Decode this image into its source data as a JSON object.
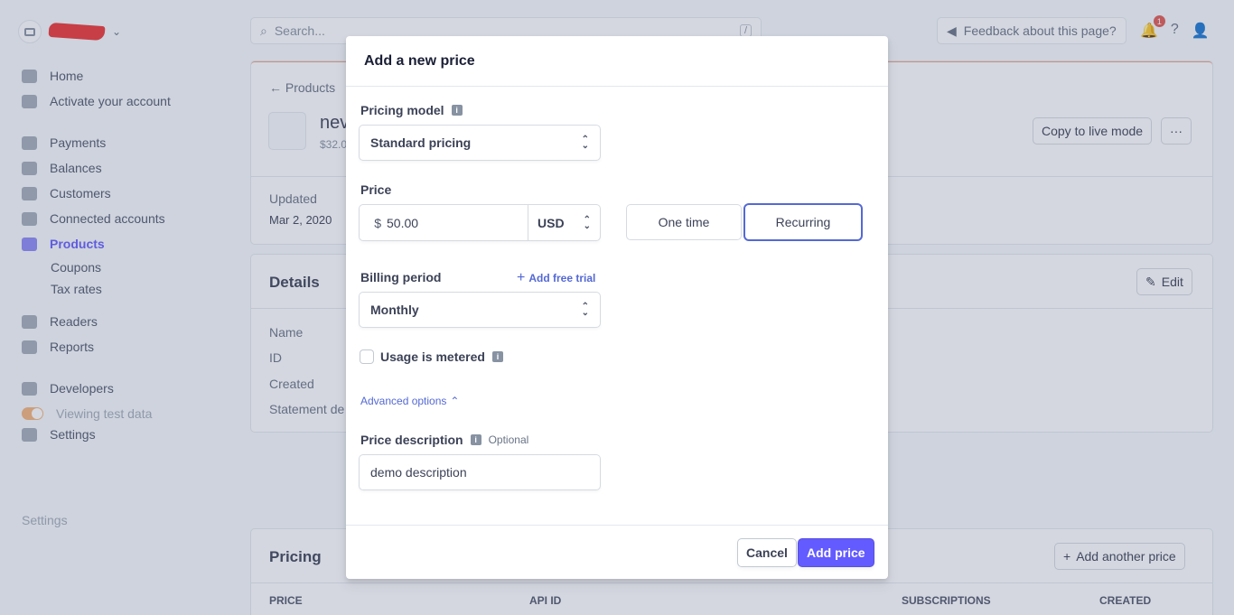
{
  "sidebar": {
    "items": [
      {
        "label": "Home",
        "icon": "home-icon"
      },
      {
        "label": "Activate your account",
        "icon": "checklist-icon"
      },
      {
        "label": "Payments",
        "icon": "card-icon"
      },
      {
        "label": "Balances",
        "icon": "arrows-icon"
      },
      {
        "label": "Customers",
        "icon": "user-circle-icon"
      },
      {
        "label": "Connected accounts",
        "icon": "globe-icon"
      },
      {
        "label": "Products",
        "icon": "box-icon"
      },
      {
        "label": "Coupons"
      },
      {
        "label": "Tax rates"
      },
      {
        "label": "Readers",
        "icon": "reader-icon"
      },
      {
        "label": "Reports",
        "icon": "bar-chart-icon"
      },
      {
        "label": "Developers",
        "icon": "terminal-icon"
      },
      {
        "label": "Viewing test data"
      },
      {
        "label": "Settings",
        "icon": "gear-icon"
      }
    ],
    "settings_faded": "Settings"
  },
  "topbar": {
    "search_placeholder": "Search...",
    "search_shortcut": "/",
    "feedback": "Feedback about this page?",
    "notification_count": "1"
  },
  "product": {
    "breadcrumb": "← Products",
    "name": "nev",
    "price": "$32.0",
    "copy_live": "Copy to live mode",
    "more": "···",
    "updated_label": "Updated",
    "updated_value": "Mar 2, 2020"
  },
  "details": {
    "title": "Details",
    "edit": "Edit",
    "labels": [
      "Name",
      "ID",
      "Created",
      "Statement de"
    ]
  },
  "pricing": {
    "title": "Pricing",
    "add_another": "Add another price",
    "columns": [
      "PRICE",
      "API ID",
      "SUBSCRIPTIONS",
      "CREATED"
    ]
  },
  "modal": {
    "title": "Add a new price",
    "pricing_model_label": "Pricing model",
    "pricing_model_value": "Standard pricing",
    "price_label": "Price",
    "currency_symbol": "$",
    "price_value": "50.00",
    "currency": "USD",
    "one_time": "One time",
    "recurring": "Recurring",
    "billing_period_label": "Billing period",
    "add_free_trial": "Add free trial",
    "billing_period_value": "Monthly",
    "usage_metered": "Usage is metered",
    "advanced_options": "Advanced options",
    "price_description_label": "Price description",
    "optional": "Optional",
    "price_description_value": "demo description",
    "cancel": "Cancel",
    "add_price": "Add price"
  },
  "colors": {
    "accent": "#635bff",
    "link": "#5469d4",
    "badge": "#e25950"
  }
}
